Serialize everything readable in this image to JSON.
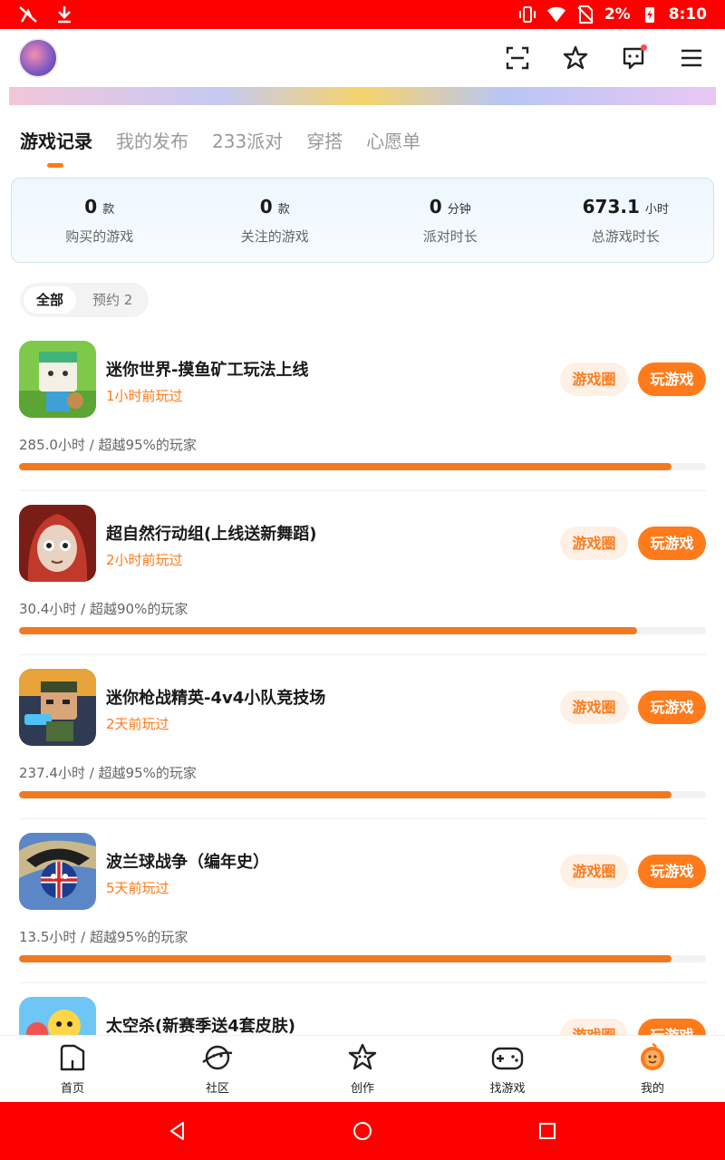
{
  "status_bar": {
    "battery": "2%",
    "time": "8:10"
  },
  "tabs": [
    {
      "label": "游戏记录",
      "active": true
    },
    {
      "label": "我的发布",
      "active": false
    },
    {
      "label": "233派对",
      "active": false
    },
    {
      "label": "穿搭",
      "active": false
    },
    {
      "label": "心愿单",
      "active": false
    }
  ],
  "stats": [
    {
      "value": "0",
      "unit": "款",
      "label": "购买的游戏"
    },
    {
      "value": "0",
      "unit": "款",
      "label": "关注的游戏"
    },
    {
      "value": "0",
      "unit": "分钟",
      "label": "派对时长"
    },
    {
      "value": "673.1",
      "unit": "小时",
      "label": "总游戏时长"
    }
  ],
  "filters": [
    {
      "label": "全部",
      "active": true
    },
    {
      "label": "预约 2",
      "active": false
    }
  ],
  "button_labels": {
    "circle": "游戏圈",
    "play": "玩游戏"
  },
  "games": [
    {
      "title": "迷你世界-摸鱼矿工玩法上线",
      "played": "1小时前玩过",
      "hours": "285.0小时 / 超越95%的玩家",
      "progress": 0.95
    },
    {
      "title": "超自然行动组(上线送新舞蹈)",
      "played": "2小时前玩过",
      "hours": "30.4小时 / 超越90%的玩家",
      "progress": 0.9
    },
    {
      "title": "迷你枪战精英-4v4小队竞技场",
      "played": "2天前玩过",
      "hours": "237.4小时 / 超越95%的玩家",
      "progress": 0.95
    },
    {
      "title": "波兰球战争（编年史）",
      "played": "5天前玩过",
      "hours": "13.5小时 / 超越95%的玩家",
      "progress": 0.95
    },
    {
      "title": "太空杀(新赛季送4套皮肤)",
      "played": "",
      "hours": "",
      "progress": 0
    }
  ],
  "bottom_nav": [
    {
      "label": "首页",
      "icon": "home-icon",
      "active": false
    },
    {
      "label": "社区",
      "icon": "community-icon",
      "active": false
    },
    {
      "label": "创作",
      "icon": "create-icon",
      "active": false
    },
    {
      "label": "找游戏",
      "icon": "gamepad-icon",
      "active": false
    },
    {
      "label": "我的",
      "icon": "profile-icon",
      "active": true
    }
  ],
  "colors": {
    "accent": "#ff7a1a",
    "status_bar": "#ff0000"
  }
}
